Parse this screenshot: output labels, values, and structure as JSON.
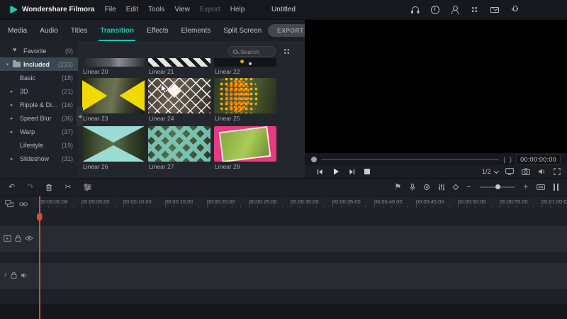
{
  "menubar": {
    "app_name": "Wondershare Filmora",
    "menus": [
      {
        "label": "File",
        "cls": ""
      },
      {
        "label": "Edit",
        "cls": ""
      },
      {
        "label": "Tools",
        "cls": ""
      },
      {
        "label": "View",
        "cls": ""
      },
      {
        "label": "Export",
        "cls": "dim"
      },
      {
        "label": "Help",
        "cls": ""
      }
    ],
    "doc_title": "Untitled",
    "icons": [
      {
        "name": "headset-icon",
        "cls": "mi-headset"
      },
      {
        "name": "info-icon",
        "cls": "mi-info"
      },
      {
        "name": "account-icon",
        "cls": "mi-account"
      },
      {
        "name": "apps-grid-icon",
        "cls": "mi-grid"
      },
      {
        "name": "mail-icon",
        "cls": "mi-mail"
      },
      {
        "name": "microphone-icon",
        "cls": "mi-mic"
      }
    ]
  },
  "tabs": [
    {
      "label": "Media",
      "cls": ""
    },
    {
      "label": "Audio",
      "cls": ""
    },
    {
      "label": "Titles",
      "cls": ""
    },
    {
      "label": "Transition",
      "cls": "active"
    },
    {
      "label": "Effects",
      "cls": ""
    },
    {
      "label": "Elements",
      "cls": ""
    },
    {
      "label": "Split Screen",
      "cls": ""
    }
  ],
  "export_label": "EXPORT",
  "sidebar": [
    {
      "arrow": "",
      "icon": "heart",
      "label": "Favorite",
      "count": "(0)",
      "cls": ""
    },
    {
      "arrow": "▾",
      "icon": "folder",
      "label": "Included",
      "count": "(233)",
      "cls": "selected"
    },
    {
      "arrow": "",
      "icon": "",
      "label": "Basic",
      "count": "(18)",
      "cls": "sub"
    },
    {
      "arrow": "▸",
      "icon": "",
      "label": "3D",
      "count": "(21)",
      "cls": "sub"
    },
    {
      "arrow": "▸",
      "icon": "",
      "label": "Ripple & Dissolve",
      "count": "(16)",
      "cls": "sub"
    },
    {
      "arrow": "▸",
      "icon": "",
      "label": "Speed Blur",
      "count": "(36)",
      "cls": "sub"
    },
    {
      "arrow": "▸",
      "icon": "",
      "label": "Warp",
      "count": "(37)",
      "cls": "sub"
    },
    {
      "arrow": "",
      "icon": "",
      "label": "Lifestyle",
      "count": "(19)",
      "cls": "sub"
    },
    {
      "arrow": "▸",
      "icon": "",
      "label": "Slideshow",
      "count": "(31)",
      "cls": "sub"
    }
  ],
  "search": {
    "placeholder": "Search"
  },
  "partial_row": [
    {
      "label": "Linear 20",
      "variant": "v20"
    },
    {
      "label": "Linear 21",
      "variant": "v21"
    },
    {
      "label": "Linear 22",
      "variant": "v22"
    }
  ],
  "transitions": [
    {
      "label": "Linear 23",
      "variant": "v23"
    },
    {
      "label": "Linear 24",
      "variant": "v24"
    },
    {
      "label": "Linear 25",
      "variant": "v25"
    },
    {
      "label": "Linear 26",
      "variant": "v26"
    },
    {
      "label": "Linear 27",
      "variant": "v27"
    },
    {
      "label": "Linear 28",
      "variant": "v28"
    }
  ],
  "preview": {
    "timecode": "00:00:00:00",
    "page_indicator": "1/2",
    "mark_in": "{",
    "mark_out": "}"
  },
  "glyphs": {
    "undo": "↶",
    "redo": "↷",
    "scissors": "✂",
    "marker": "⚑",
    "zoom_out": "−",
    "zoom_in": "+",
    "music_note": "♪",
    "collapse": "◀"
  },
  "timeline": {
    "ruler_ticks": [
      "00:00:00:00",
      "00:00:05:00",
      "00:00:10:00",
      "00:00:15:00",
      "00:00:20:00",
      "00:00:25:00",
      "00:00:30:00",
      "00:00:35:00",
      "00:00:40:00",
      "00:00:45:00",
      "00:00:50:00",
      "00:00:55:00",
      "00:01:00:00"
    ]
  }
}
